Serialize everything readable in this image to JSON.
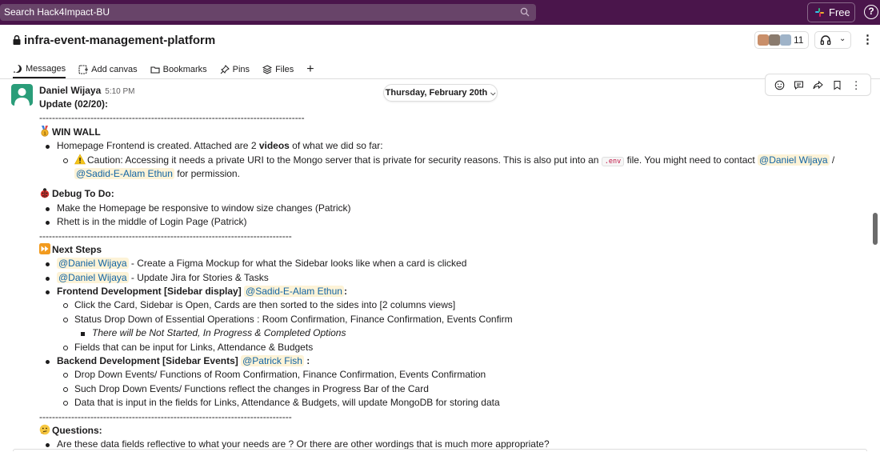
{
  "topbar": {
    "search_placeholder": "Search Hack4Impact-BU",
    "free_label": "Free",
    "help_label": "?"
  },
  "channel": {
    "name": "infra-event-management-platform",
    "member_count": "11",
    "tabs": [
      {
        "label": "Messages",
        "icon": "message-icon"
      },
      {
        "label": "Add canvas",
        "icon": "canvas-icon"
      },
      {
        "label": "Bookmarks",
        "icon": "folder-icon"
      },
      {
        "label": "Pins",
        "icon": "pin-icon"
      },
      {
        "label": "Files",
        "icon": "files-icon"
      },
      {
        "label": "+",
        "icon": "plus-icon"
      }
    ]
  },
  "date_divider": "Thursday, February 20th",
  "message": {
    "author": "Daniel Wijaya",
    "time": "5:10 PM",
    "title": "Update (02/20):",
    "divider1": "-----------------------------------------------------------------------------------",
    "win_wall": "WIN WALL",
    "win_item_1_a": "Homepage Frontend is created. Attached are 2 ",
    "win_item_1_b": "videos",
    "win_item_1_c": " of what we did so far:",
    "caution_a": "Caution: Accessing it needs a private URI to the Mongo server that is private for security reasons. This is also put into an ",
    "caution_code": ".env",
    "caution_b": " file. You might need to contact ",
    "mention_daniel": "@Daniel Wijaya",
    "slash": " /",
    "mention_sadid": "@Sadid-E-Alam Ethun",
    "for_permission": " for permission.",
    "debug_title": "Debug To Do:",
    "debug_1": "Make the Homepage be responsive to window size changes (Patrick)",
    "debug_2": "Rhett is in the middle of Login Page (Patrick)",
    "divider2": "-------------------------------------------------------------------------------",
    "next_title": "Next Steps",
    "next_1_mention": "@Daniel Wijaya",
    "next_1_text": " - Create a Figma Mockup for what the Sidebar looks like when a card is clicked",
    "next_2_mention": "@Daniel Wijaya",
    "next_2_text": " - Update Jira for Stories & Tasks",
    "frontend_title": "Frontend Development [Sidebar display]",
    "frontend_mention": "@Sadid-E-Alam Ethun",
    "frontend_colon": ":",
    "fe_1": "Click the Card, Sidebar is Open, Cards are then sorted to the sides into [2 columns views]",
    "fe_2": "Status Drop Down of Essential Operations : Room Confirmation, Finance Confirmation, Events Confirm",
    "fe_2_sub": "There will be Not Started, In Progress & Completed Options",
    "fe_3": "Fields that can be input for Links, Attendance & Budgets",
    "backend_title": "Backend Development [Sidebar Events]",
    "backend_mention": "@Patrick Fish",
    "backend_colon": " :",
    "be_1": "Drop Down Events/ Functions of Room Confirmation, Finance Confirmation, Events Confirmation",
    "be_2": "Such Drop Down Events/ Functions reflect the changes in Progress Bar of the Card",
    "be_3": "Data that is input in the fields for Links, Attendance & Budgets, will update MongoDB for storing data",
    "divider3": "-------------------------------------------------------------------------------",
    "questions_title": "Questions:",
    "q_1": "Are these data fields reflective to what your needs are ? Or there are other wordings that is much more appropriate?"
  },
  "colors": {
    "topbar": "#4a154b",
    "mention_text": "#1264a3",
    "mention_bg": "#fdf3d7",
    "avatar": "#2a9d79"
  }
}
